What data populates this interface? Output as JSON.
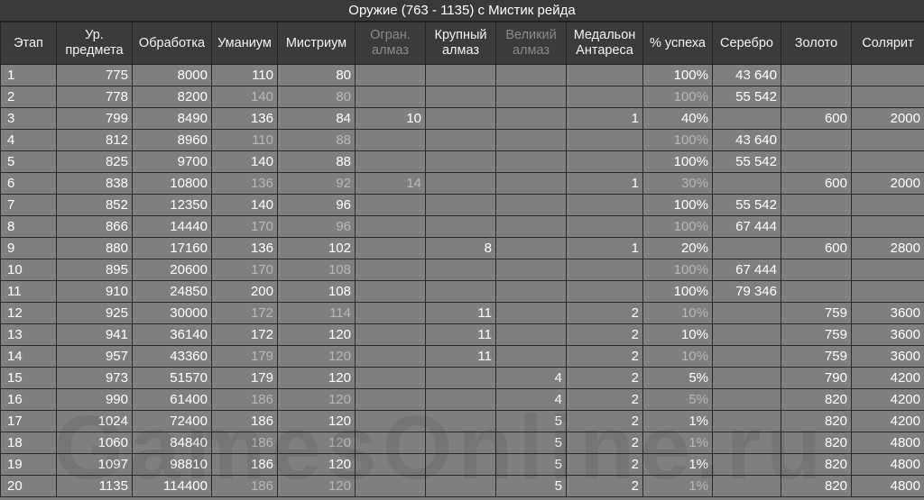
{
  "title": "Оружие (763 - 1135) с Мистик рейда",
  "headers": [
    {
      "label": "Этап",
      "dim": false
    },
    {
      "label": "Ур. предмета",
      "dim": false
    },
    {
      "label": "Обработка",
      "dim": false
    },
    {
      "label": "Уманиум",
      "dim": false
    },
    {
      "label": "Мистриум",
      "dim": false
    },
    {
      "label": "Огран. алмаз",
      "dim": true
    },
    {
      "label": "Крупный алмаз",
      "dim": false
    },
    {
      "label": "Великий алмаз",
      "dim": true
    },
    {
      "label": "Медальон Антареса",
      "dim": false
    },
    {
      "label": "% успеха",
      "dim": false
    },
    {
      "label": "Серебро",
      "dim": false
    },
    {
      "label": "Золото",
      "dim": false
    },
    {
      "label": "Солярит",
      "dim": false
    }
  ],
  "rows": [
    [
      "1",
      "775",
      "8000",
      "110",
      "80",
      "",
      "",
      "",
      "",
      "100%",
      "43 640",
      "",
      ""
    ],
    [
      "2",
      "778",
      "8200",
      "140",
      "80",
      "",
      "",
      "",
      "",
      "100%",
      "55 542",
      "",
      ""
    ],
    [
      "3",
      "799",
      "8490",
      "136",
      "84",
      "10",
      "",
      "",
      "1",
      "40%",
      "",
      "600",
      "2000"
    ],
    [
      "4",
      "812",
      "8960",
      "110",
      "88",
      "",
      "",
      "",
      "",
      "100%",
      "43 640",
      "",
      ""
    ],
    [
      "5",
      "825",
      "9700",
      "140",
      "88",
      "",
      "",
      "",
      "",
      "100%",
      "55 542",
      "",
      ""
    ],
    [
      "6",
      "838",
      "10800",
      "136",
      "92",
      "14",
      "",
      "",
      "1",
      "30%",
      "",
      "600",
      "2000"
    ],
    [
      "7",
      "852",
      "12350",
      "140",
      "96",
      "",
      "",
      "",
      "",
      "100%",
      "55 542",
      "",
      ""
    ],
    [
      "8",
      "866",
      "14440",
      "170",
      "96",
      "",
      "",
      "",
      "",
      "100%",
      "67 444",
      "",
      ""
    ],
    [
      "9",
      "880",
      "17160",
      "136",
      "102",
      "",
      "8",
      "",
      "1",
      "20%",
      "",
      "600",
      "2800"
    ],
    [
      "10",
      "895",
      "20600",
      "170",
      "108",
      "",
      "",
      "",
      "",
      "100%",
      "67 444",
      "",
      ""
    ],
    [
      "11",
      "910",
      "24850",
      "200",
      "108",
      "",
      "",
      "",
      "",
      "100%",
      "79 346",
      "",
      ""
    ],
    [
      "12",
      "925",
      "30000",
      "172",
      "114",
      "",
      "11",
      "",
      "2",
      "10%",
      "",
      "759",
      "3600"
    ],
    [
      "13",
      "941",
      "36140",
      "172",
      "120",
      "",
      "11",
      "",
      "2",
      "10%",
      "",
      "759",
      "3600"
    ],
    [
      "14",
      "957",
      "43360",
      "179",
      "120",
      "",
      "11",
      "",
      "2",
      "10%",
      "",
      "759",
      "3600"
    ],
    [
      "15",
      "973",
      "51570",
      "179",
      "120",
      "",
      "",
      "4",
      "2",
      "5%",
      "",
      "790",
      "4200"
    ],
    [
      "16",
      "990",
      "61400",
      "186",
      "120",
      "",
      "",
      "4",
      "2",
      "5%",
      "",
      "820",
      "4200"
    ],
    [
      "17",
      "1024",
      "72400",
      "186",
      "120",
      "",
      "",
      "5",
      "2",
      "1%",
      "",
      "820",
      "4200"
    ],
    [
      "18",
      "1060",
      "84840",
      "186",
      "120",
      "",
      "",
      "5",
      "2",
      "1%",
      "",
      "820",
      "4800"
    ],
    [
      "19",
      "1097",
      "98810",
      "186",
      "120",
      "",
      "",
      "5",
      "2",
      "1%",
      "",
      "820",
      "4800"
    ],
    [
      "20",
      "1135",
      "114400",
      "186",
      "120",
      "",
      "",
      "5",
      "2",
      "1%",
      "",
      "820",
      "4800"
    ]
  ],
  "watermark": "GamesOnline.ru"
}
